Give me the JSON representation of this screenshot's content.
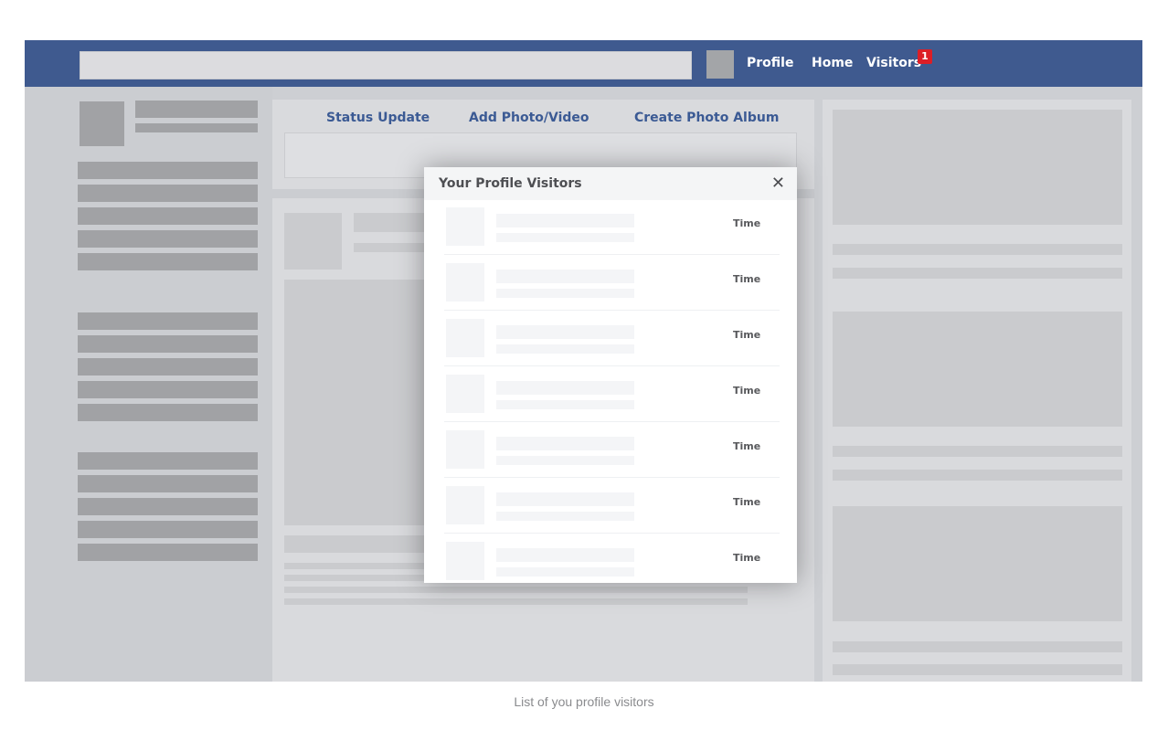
{
  "nav": {
    "profile_label": "Profile",
    "home_label": "Home",
    "visitors_label": "Visitors",
    "visitors_badge": "1"
  },
  "composer": {
    "tabs": [
      "Status Update",
      "Add Photo/Video",
      "Create Photo Album"
    ]
  },
  "modal": {
    "title": "Your Profile Visitors",
    "close_symbol": "✕",
    "rows": [
      {
        "time": "Time"
      },
      {
        "time": "Time"
      },
      {
        "time": "Time"
      },
      {
        "time": "Time"
      },
      {
        "time": "Time"
      },
      {
        "time": "Time"
      },
      {
        "time": "Time"
      }
    ]
  },
  "caption": "List of you profile visitors",
  "colors": {
    "topbar": "#3f5a8f",
    "link": "#3b5a94",
    "badge": "#dc1e26"
  }
}
